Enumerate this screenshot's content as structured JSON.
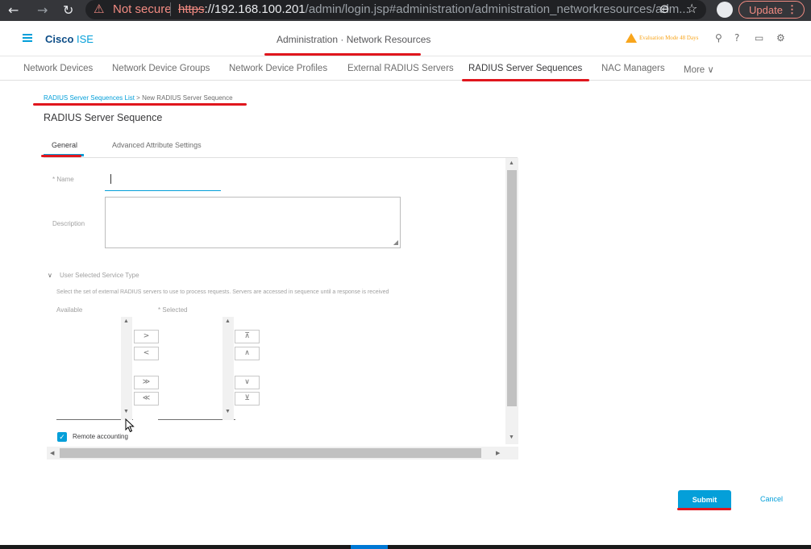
{
  "browser": {
    "not_secure": "Not secure",
    "url_scheme": "https",
    "url_host": "://192.168.100.201",
    "url_path": "/admin/login.jsp#administration/administration_networkresources/adm...",
    "update_label": "Update"
  },
  "header": {
    "brand_bold": "Cisco",
    "brand_light": " ISE",
    "title": "Administration · Network Resources",
    "eval_text": "Evaluation Mode 48 Days"
  },
  "tabs": [
    {
      "label": "Network Devices"
    },
    {
      "label": "Network Device Groups"
    },
    {
      "label": "Network Device Profiles"
    },
    {
      "label": "External RADIUS Servers"
    },
    {
      "label": "RADIUS Server Sequences"
    },
    {
      "label": "NAC Managers"
    },
    {
      "label": "More ∨"
    }
  ],
  "breadcrumb": {
    "parent": "RADIUS Server Sequences List",
    "sep": " > ",
    "current": "New RADIUS Server Sequence"
  },
  "section_title": "RADIUS Server Sequence",
  "subtabs": [
    {
      "label": "General"
    },
    {
      "label": "Advanced Attribute Settings"
    }
  ],
  "form": {
    "name_label": "* Name",
    "name_value": "",
    "description_label": "Description",
    "service_type_label": "User Selected Service Type",
    "service_desc": "Select the set of external RADIUS servers to use to process requests. Servers are accessed in sequence until a response is received",
    "available_label": "Available",
    "selected_label": "* Selected",
    "remote_accounting_label": "Remote accounting",
    "remote_accounting_checked": true
  },
  "buttons": {
    "move_right": ">",
    "move_left": "<",
    "move_all_right": "≫",
    "move_all_left": "≪",
    "move_top": "⊼",
    "move_up": "∧",
    "move_down": "∨",
    "move_bottom": "⊻",
    "submit": "Submit",
    "cancel": "Cancel"
  },
  "colors": {
    "accent": "#049fd9",
    "warning": "#f8a51c",
    "annotation": "#e0161d"
  }
}
